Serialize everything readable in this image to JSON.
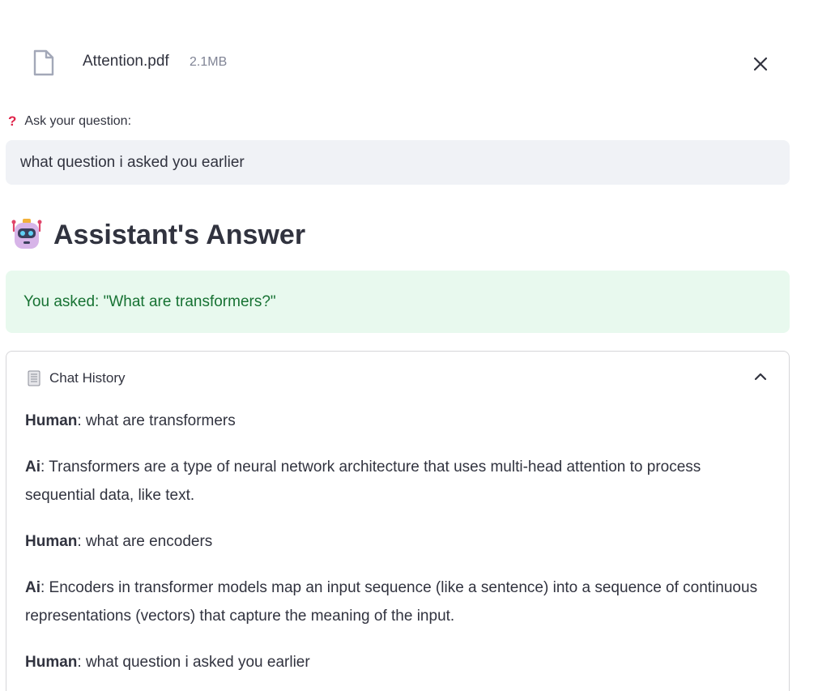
{
  "file": {
    "name": "Attention.pdf",
    "size": "2.1MB",
    "icon": "file-icon",
    "close_icon": "close-icon"
  },
  "question": {
    "mark": "?",
    "label": "Ask your question:",
    "value": "what question i asked you earlier"
  },
  "answer": {
    "heading": "Assistant's Answer",
    "icon": "robot-icon",
    "text": "You asked: \"What are transformers?\""
  },
  "history": {
    "title": "Chat History",
    "icon": "scroll-icon",
    "expanded": true,
    "messages": [
      {
        "role": "Human",
        "text": ": what are transformers"
      },
      {
        "role": "Ai",
        "text": ": Transformers are a type of neural network architecture that uses multi-head attention to process sequential data, like text."
      },
      {
        "role": "Human",
        "text": ": what are encoders"
      },
      {
        "role": "Ai",
        "text": ": Encoders in transformer models map an input sequence (like a sentence) into a sequence of continuous representations (vectors) that capture the meaning of the input."
      },
      {
        "role": "Human",
        "text": ": what question i asked you earlier"
      }
    ]
  },
  "colors": {
    "text": "#31333f",
    "muted": "#808495",
    "input_bg": "#f0f2f6",
    "success_bg": "#e8f9ee",
    "success_text": "#177233",
    "question_mark": "#e0244a"
  }
}
